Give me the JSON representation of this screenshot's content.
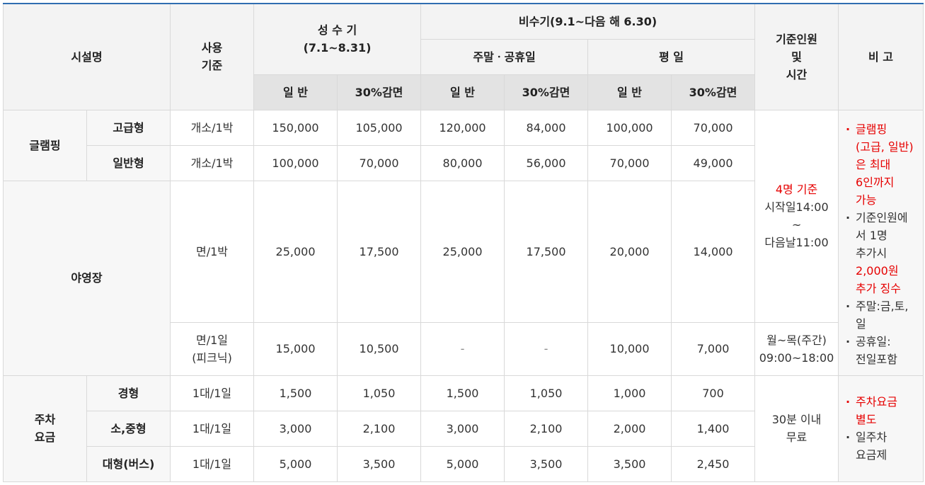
{
  "header": {
    "facility": "시설명",
    "usage": "사용\n기준",
    "peak": {
      "label": "성 수 기",
      "period": "(7.1∼8.31)"
    },
    "offpeak": {
      "label": "비수기(9.1∼다음 해 6.30)"
    },
    "weekend_holiday": "주말ㆍ공휴일",
    "weekday": "평 일",
    "basis": "기준인원\n및\n시간",
    "remarks": "비 고",
    "general": "일 반",
    "discount": "30%감면"
  },
  "rows": {
    "glamping": {
      "label": "글램핑",
      "premium": {
        "type": "고급형",
        "unit": "개소/1박",
        "values": [
          "150,000",
          "105,000",
          "120,000",
          "84,000",
          "100,000",
          "70,000"
        ]
      },
      "standard": {
        "type": "일반형",
        "unit": "개소/1박",
        "values": [
          "100,000",
          "70,000",
          "80,000",
          "56,000",
          "70,000",
          "49,000"
        ]
      }
    },
    "campsite": {
      "label": "야영장",
      "night": {
        "unit": "면/1박",
        "values": [
          "25,000",
          "17,500",
          "25,000",
          "17,500",
          "20,000",
          "14,000"
        ]
      },
      "picnic": {
        "unit": "면/1일\n(피크닉)",
        "values": [
          "15,000",
          "10,500",
          "-",
          "-",
          "10,000",
          "7,000"
        ]
      }
    },
    "parking": {
      "label": "주차\n요금",
      "compact": {
        "type": "경형",
        "unit": "1대/1일",
        "values": [
          "1,500",
          "1,050",
          "1,500",
          "1,050",
          "1,000",
          "700"
        ]
      },
      "mid": {
        "type": "소,중형",
        "unit": "1대/1일",
        "values": [
          "3,000",
          "2,100",
          "3,000",
          "2,100",
          "2,000",
          "1,400"
        ]
      },
      "large": {
        "type": "대형(버스)",
        "unit": "1대/1일",
        "values": [
          "5,000",
          "3,500",
          "5,000",
          "3,500",
          "3,500",
          "2,450"
        ]
      }
    }
  },
  "basis": {
    "lodging_red": "4명 기준",
    "lodging_time": "시작일14:00\n~\n다음날11:00",
    "picnic_time": "월~목(주간)\n09:00~18:00",
    "parking": "30분 이내\n무료"
  },
  "remarks": {
    "bullet": "·",
    "lodging_1": "글램핑\n(고급, 일반)\n은 최대\n6인까지\n가능",
    "lodging_2a": "기준인원에\n서 1명\n추가시",
    "lodging_2b": "2,000원\n추가 징수",
    "lodging_3": "주말:금,토,\n일",
    "lodging_4": "공휴일:\n전일포함",
    "parking_1": "주차요금\n별도",
    "parking_2": "일주차\n요금제"
  },
  "colors": {
    "accent_border": "#2f6db1",
    "highlight_red": "#e60000",
    "header_bg": "#e3e3e3",
    "subheader_bg": "#f3f3f3"
  }
}
